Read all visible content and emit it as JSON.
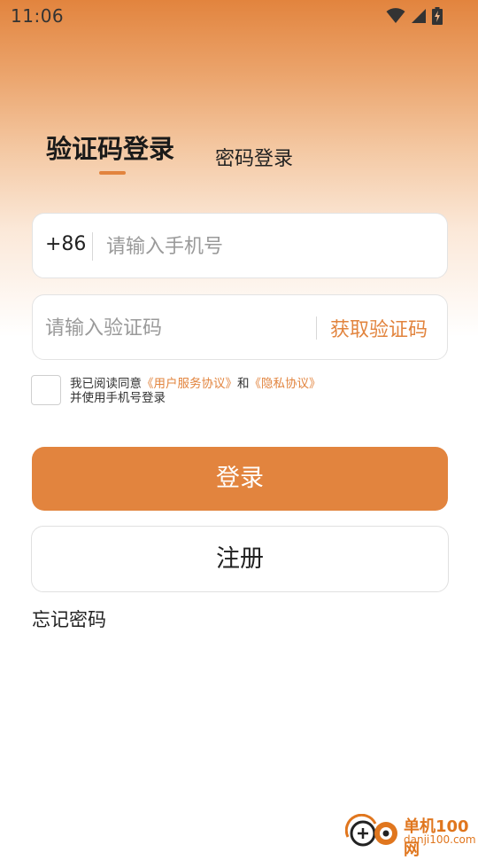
{
  "status_bar": {
    "time": "11:06"
  },
  "tabs": {
    "active_label": "验证码登录",
    "inactive_label": "密码登录"
  },
  "phone_field": {
    "country_code": "+86",
    "placeholder": "请输入手机号",
    "value": ""
  },
  "code_field": {
    "placeholder": "请输入验证码",
    "value": "",
    "get_code_label": "获取验证码"
  },
  "agreement": {
    "checked": false,
    "prefix": "我已阅读同意",
    "user_agreement_link": "《用户服务协议》",
    "conjunction": "和",
    "privacy_link": "《隐私协议》",
    "suffix": "并使用手机号登录"
  },
  "buttons": {
    "login_label": "登录",
    "register_label": "注册"
  },
  "forgot_password_label": "忘记密码",
  "watermark": {
    "brand": "单机100网",
    "domain": "danji100.com"
  },
  "colors": {
    "accent": "#e2843e",
    "gradient_top": "#e2843e"
  },
  "icons": {
    "wifi": "wifi-icon",
    "signal": "cell-signal-icon",
    "battery": "battery-charging-icon"
  }
}
